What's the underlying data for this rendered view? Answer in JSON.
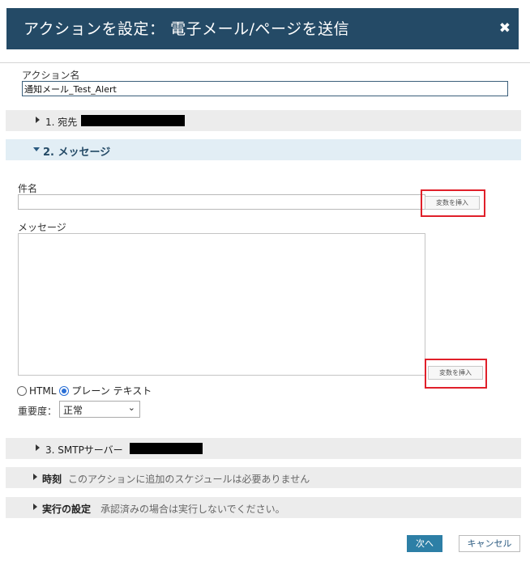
{
  "dialog": {
    "title": "アクションを設定： 電子メール/ページを送信",
    "close_icon": "✖"
  },
  "action_name": {
    "label": "アクション名",
    "value": "通知メール_Test_Alert"
  },
  "sections": {
    "recipients": {
      "label": "1. 宛先"
    },
    "message": {
      "label": "2. メッセージ"
    },
    "smtp": {
      "label": "3. SMTPサーバー"
    },
    "time": {
      "label": "時刻",
      "description": "このアクションに追加のスケジュールは必要ありません"
    },
    "execution": {
      "label": "実行の設定",
      "description": "承認済みの場合は実行しないでください。"
    }
  },
  "subject": {
    "label": "件名",
    "value": "",
    "insert_variable": "変数を挿入"
  },
  "message_body": {
    "label": "メッセージ",
    "value": "",
    "insert_variable": "変数を挿入"
  },
  "format": {
    "html_label": "HTML",
    "plain_label": "プレーン テキスト",
    "selected": "plain"
  },
  "priority": {
    "label": "重要度：",
    "value": "正常"
  },
  "buttons": {
    "next": "次へ",
    "cancel": "キャンセル"
  },
  "colors": {
    "header_bg": "#244a66",
    "primary_button": "#2d7fa6",
    "highlight_box": "#e0202a"
  }
}
